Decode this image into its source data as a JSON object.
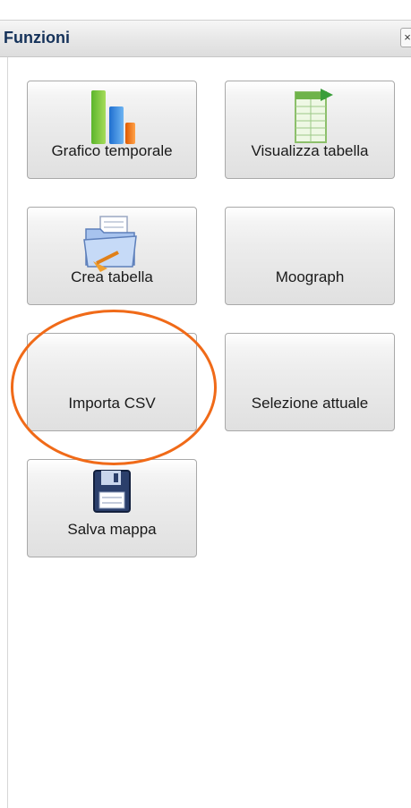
{
  "panel": {
    "title": "Funzioni",
    "close_label": "×"
  },
  "buttons": [
    {
      "label": "Grafico temporale",
      "icon": "bar-chart-icon"
    },
    {
      "label": "Visualizza tabella",
      "icon": "spreadsheet-icon"
    },
    {
      "label": "Crea tabella",
      "icon": "folder-icon"
    },
    {
      "label": "Moograph",
      "icon": ""
    },
    {
      "label": "Importa CSV",
      "icon": ""
    },
    {
      "label": "Selezione attuale",
      "icon": ""
    },
    {
      "label": "Salva mappa",
      "icon": "floppy-disk-icon"
    }
  ],
  "annotation": {
    "highlight_color": "#f06a18"
  },
  "colors": {
    "header_title": "#15325a",
    "button_border": "#a9a9a9"
  }
}
